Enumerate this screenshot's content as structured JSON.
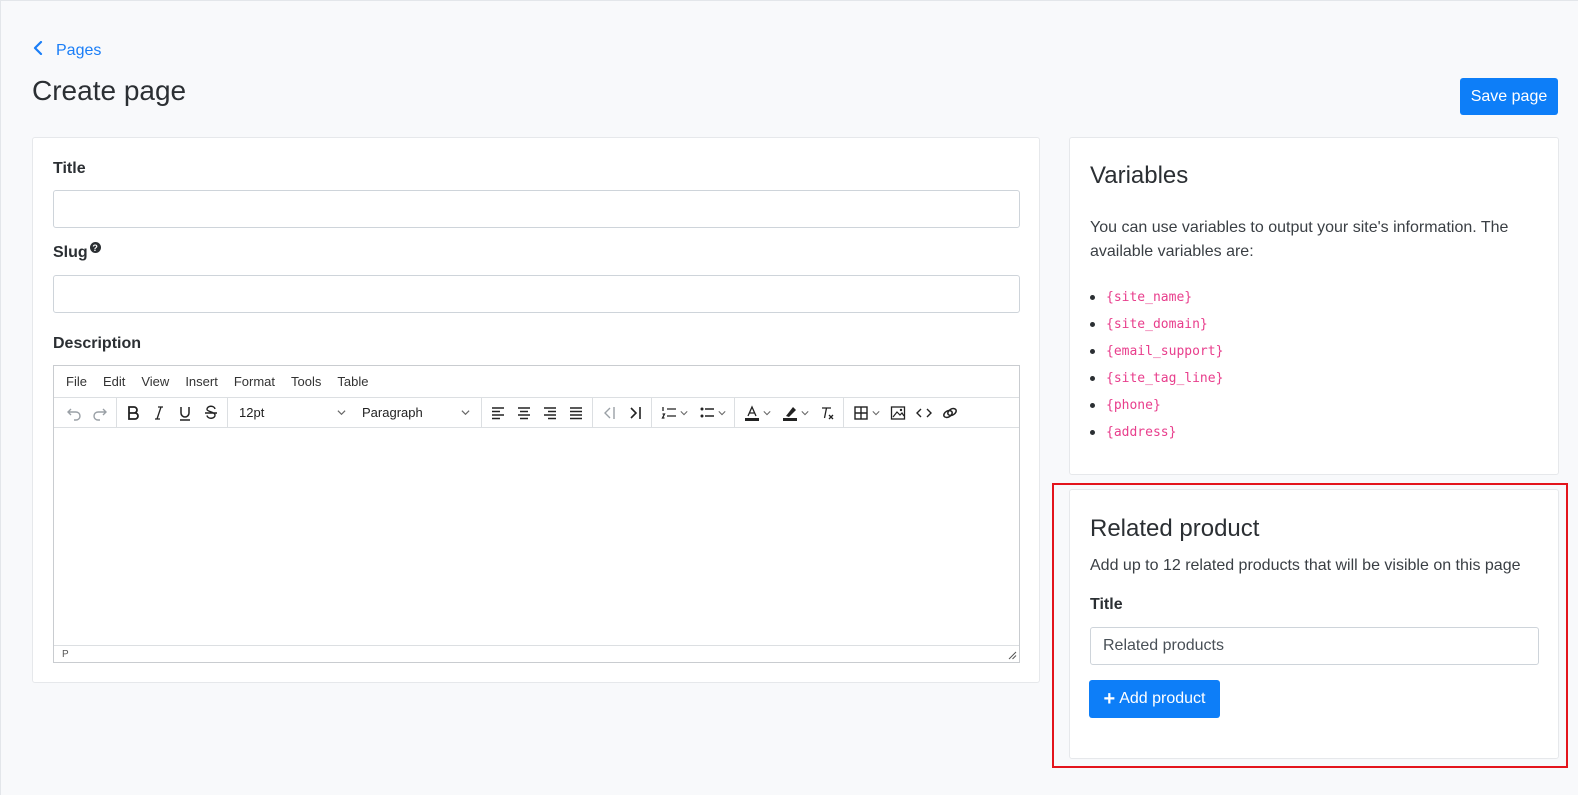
{
  "breadcrumb": {
    "label": "Pages"
  },
  "header": {
    "title": "Create page",
    "save_label": "Save page"
  },
  "form": {
    "title_label": "Title",
    "title_value": "",
    "slug_label": "Slug",
    "slug_help_glyph": "?",
    "slug_value": "",
    "description_label": "Description"
  },
  "editor": {
    "menu": [
      "File",
      "Edit",
      "View",
      "Insert",
      "Format",
      "Tools",
      "Table"
    ],
    "font_size": "12pt",
    "block_format": "Paragraph",
    "status_path": "P",
    "toolbar_icons": [
      "undo-icon",
      "redo-icon",
      "bold-icon",
      "italic-icon",
      "underline-icon",
      "strikethrough-icon",
      "align-left-icon",
      "align-center-icon",
      "align-right-icon",
      "align-justify-icon",
      "outdent-icon",
      "indent-icon",
      "numbered-list-icon",
      "bullet-list-icon",
      "text-color-icon",
      "highlight-icon",
      "clear-format-icon",
      "table-icon",
      "image-icon",
      "code-icon",
      "link-icon"
    ]
  },
  "variables": {
    "title": "Variables",
    "description": "You can use variables to output your site's information. The available variables are:",
    "items": [
      "{site_name}",
      "{site_domain}",
      "{email_support}",
      "{site_tag_line}",
      "{phone}",
      "{address}"
    ]
  },
  "related": {
    "title": "Related product",
    "description": "Add up to 12 related products that will be visible on this page",
    "title_label": "Title",
    "title_value": "Related products",
    "add_label": "Add product"
  },
  "colors": {
    "primary": "#0d7ef8",
    "link": "#1a7ef7",
    "code": "#e83e8c",
    "highlight_border": "#e3141c"
  }
}
